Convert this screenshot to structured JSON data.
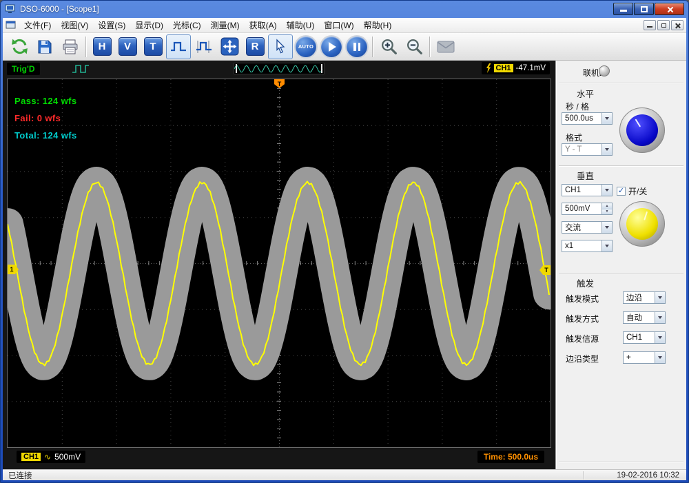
{
  "colors": {
    "trace": "#ffff00",
    "mask": "#9a9a9a",
    "pass": "#00dd00",
    "fail": "#ff2a2a",
    "total": "#00cccc",
    "time": "#ff9000",
    "trig_status": "#00d000",
    "titlebar": "#2b5cc8",
    "accent_blue": "#1c4aa4",
    "knob_blue": "#0808c8",
    "knob_yellow": "#efe000"
  },
  "window": {
    "title": "DSO-6000 - [Scope1]"
  },
  "menu": {
    "items": [
      "文件(F)",
      "视图(V)",
      "设置(S)",
      "显示(D)",
      "光标(C)",
      "测量(M)",
      "获取(A)",
      "辅助(U)",
      "窗口(W)",
      "帮助(H)"
    ]
  },
  "toolbar": {
    "h": "H",
    "v": "V",
    "t": "T",
    "r": "R",
    "auto": "AUTO"
  },
  "trig": {
    "status": "Trig'D",
    "channel": "CH1",
    "level": "-47.1mV",
    "preview_cycles": 9
  },
  "scope": {
    "pass_text": "Pass: 124 wfs",
    "fail_text": "Fail: 0 wfs",
    "total_text": "Total: 124 wfs",
    "marker_top": "T",
    "marker_left": "1",
    "marker_right": "T",
    "readout": {
      "channel": "CH1",
      "coupling": "∿",
      "scale": "500mV",
      "time": "Time: 500.0us"
    },
    "waveform": {
      "type": "sine",
      "cycles_visible": 5,
      "volts_per_div": "500mV",
      "time_per_div": "500.0us",
      "amp": 132,
      "period": 153.3,
      "phase": 90.7,
      "center": 282,
      "noise": 2,
      "mask_width": 46,
      "mask_color": "#9a9a9a",
      "trace_color": "#ffff00"
    }
  },
  "panel": {
    "online_label": "联机:",
    "horizontal": {
      "title": "水平",
      "sec_label": "秒 / 格",
      "sec_value": "500.0us",
      "fmt_label": "格式",
      "fmt_value": "Y - T"
    },
    "vertical": {
      "title": "垂直",
      "channel": "CH1",
      "switch_label": "开/关",
      "scale": "500mV",
      "coupling": "交流",
      "probe": "x1"
    },
    "trigger": {
      "title": "触发",
      "mode_label": "触发模式",
      "mode_value": "边沿",
      "sweep_label": "触发方式",
      "sweep_value": "自动",
      "source_label": "触发信源",
      "source_value": "CH1",
      "slope_label": "边沿类型",
      "slope_value": "+"
    }
  },
  "statusbar": {
    "left": "已连接",
    "right": "19-02-2016  10:32"
  }
}
